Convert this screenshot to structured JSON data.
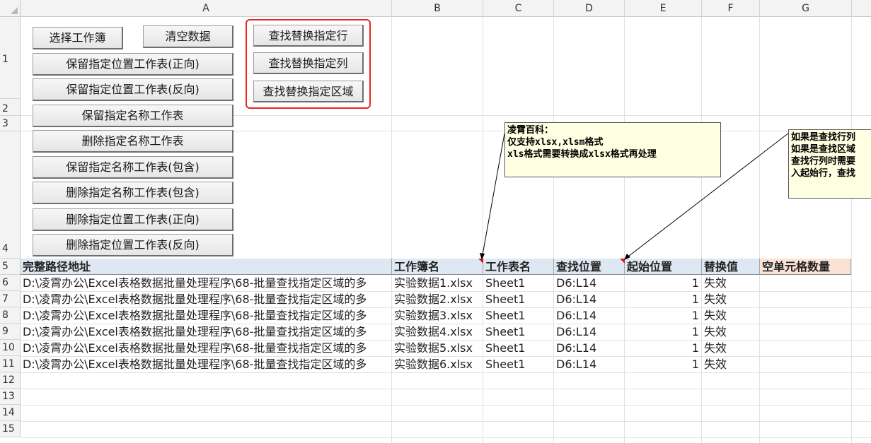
{
  "columns": [
    "A",
    "B",
    "C",
    "D",
    "E",
    "F",
    "G"
  ],
  "rows": [
    "1",
    "2",
    "3",
    "4",
    "5",
    "6",
    "7",
    "8",
    "9",
    "10",
    "11",
    "12",
    "13",
    "14",
    "15"
  ],
  "buttons": {
    "select_workbook": "选择工作簿",
    "clear_data": "清空数据",
    "keep_pos_forward": "保留指定位置工作表(正向)",
    "keep_pos_reverse": "保留指定位置工作表(反向)",
    "keep_name": "保留指定名称工作表",
    "delete_name": "删除指定名称工作表",
    "keep_name_contains": "保留指定名称工作表(包含)",
    "delete_name_contains": "删除指定名称工作表(包含)",
    "delete_pos_forward": "删除指定位置工作表(正向)",
    "delete_pos_reverse": "删除指定位置工作表(反向)",
    "find_replace_row": "查找替换指定行",
    "find_replace_col": "查找替换指定列",
    "find_replace_range": "查找替换指定区域"
  },
  "table": {
    "headers": [
      "完整路径地址",
      "工作簿名",
      "工作表名",
      "查找位置",
      "起始位置",
      "替换值",
      "空单元格数量"
    ],
    "rows": [
      {
        "path": "D:\\凌霄办公\\Excel表格数据批量处理程序\\68-批量查找指定区域的多",
        "book": "实验数据1.xlsx",
        "sheet": "Sheet1",
        "loc": "D6:L14",
        "start": "1",
        "value": "失效"
      },
      {
        "path": "D:\\凌霄办公\\Excel表格数据批量处理程序\\68-批量查找指定区域的多",
        "book": "实验数据2.xlsx",
        "sheet": "Sheet1",
        "loc": "D6:L14",
        "start": "1",
        "value": "失效"
      },
      {
        "path": "D:\\凌霄办公\\Excel表格数据批量处理程序\\68-批量查找指定区域的多",
        "book": "实验数据3.xlsx",
        "sheet": "Sheet1",
        "loc": "D6:L14",
        "start": "1",
        "value": "失效"
      },
      {
        "path": "D:\\凌霄办公\\Excel表格数据批量处理程序\\68-批量查找指定区域的多",
        "book": "实验数据4.xlsx",
        "sheet": "Sheet1",
        "loc": "D6:L14",
        "start": "1",
        "value": "失效"
      },
      {
        "path": "D:\\凌霄办公\\Excel表格数据批量处理程序\\68-批量查找指定区域的多",
        "book": "实验数据5.xlsx",
        "sheet": "Sheet1",
        "loc": "D6:L14",
        "start": "1",
        "value": "失效"
      },
      {
        "path": "D:\\凌霄办公\\Excel表格数据批量处理程序\\68-批量查找指定区域的多",
        "book": "实验数据6.xlsx",
        "sheet": "Sheet1",
        "loc": "D6:L14",
        "start": "1",
        "value": "失效"
      }
    ]
  },
  "comments": {
    "note1": "凌霄百科：\n仅支持xlsx,xlsm格式\nxls格式需要转换成xlsx格式再处理",
    "note2": "如果是查找行列\n如果是查找区域\n查找行列时需要\n入起始行，查找"
  },
  "colors": {
    "red_box": "#e8261e",
    "header_fill": "#dde8f3",
    "empty_count_fill": "#fbe2d5",
    "comment_fill": "#ffffe1"
  }
}
